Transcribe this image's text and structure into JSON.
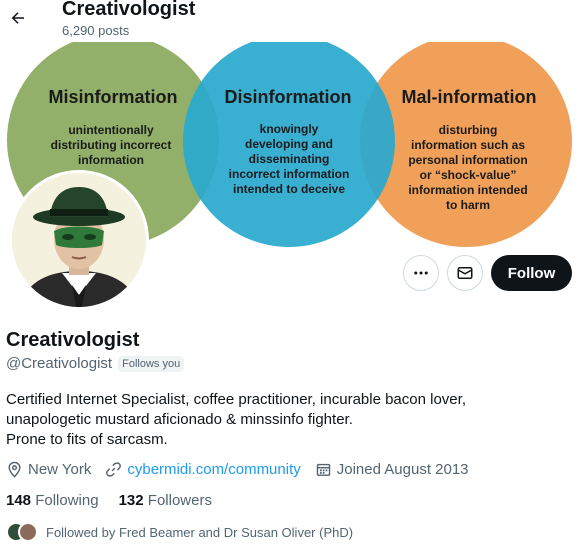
{
  "header": {
    "back_icon": "arrow-left-icon",
    "title": "Creativologist",
    "posts": "6,290 posts"
  },
  "banner": {
    "circles": [
      {
        "title": "Misinformation",
        "lines": [
          "unintentionally",
          "distributing incorrect",
          "information"
        ],
        "color": "#93b06a"
      },
      {
        "title": "Disinformation",
        "lines": [
          "knowingly",
          "developing and",
          "disseminating",
          "incorrect information",
          "intended to deceive"
        ],
        "color": "#2aa9cf"
      },
      {
        "title": "Mal-information",
        "lines": [
          "disturbing",
          "information such as",
          "personal information",
          "or “shock-value”",
          "information intended",
          "to harm"
        ],
        "color": "#f0a058"
      }
    ]
  },
  "actions": {
    "more_icon": "more-dots-icon",
    "message_icon": "envelope-icon",
    "follow_label": "Follow"
  },
  "profile": {
    "display_name": "Creativologist",
    "handle": "@Creativologist",
    "follows_you": "Follows you",
    "bio_lines": [
      "Certified Internet Specialist, coffee practitioner, incurable bacon lover,",
      "unapologetic mustard aficionado & minssinfo fighter.",
      "Prone to fits of sarcasm."
    ],
    "location": "New York",
    "website": "cybermidi.com/community",
    "joined": "Joined August 2013",
    "following_count": "148",
    "following_label": "Following",
    "followers_count": "132",
    "followers_label": "Followers",
    "followed_by": "Followed by Fred Beamer and Dr Susan Oliver (PhD)"
  },
  "colors": {
    "accent": "#1d9bf0",
    "text": "#0f1419",
    "secondary": "#536471"
  }
}
